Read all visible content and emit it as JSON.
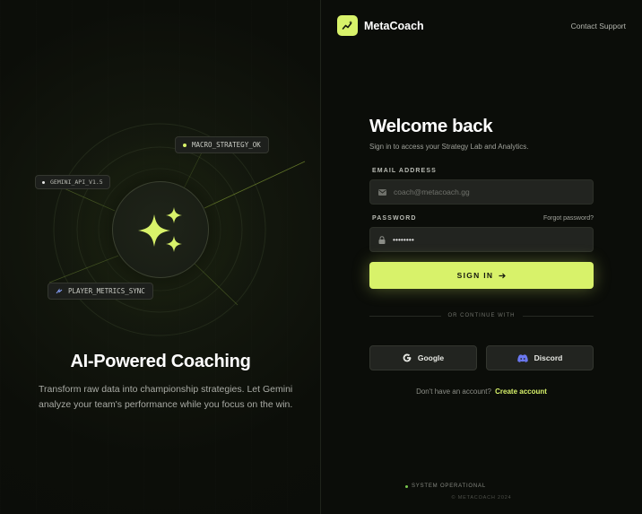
{
  "hero": {
    "title": "AI-Powered Coaching",
    "description": "Transform raw data into championship strategies. Let Gemini analyze your team's performance while you focus on the win.",
    "chips": {
      "gemini": "GEMINI_API_V1.5",
      "macro": "MACRO_STRATEGY_OK",
      "player": "PLAYER_METRICS_SYNC"
    },
    "icon": "sparkles-icon"
  },
  "brand": {
    "name": "MetaCoach",
    "logo_icon": "chart-sparkle-icon",
    "accent": "#d8f26a"
  },
  "header": {
    "support_label": "Contact Support"
  },
  "form": {
    "title": "Welcome back",
    "subtitle": "Sign in to access your Strategy Lab and Analytics.",
    "email": {
      "label": "EMAIL ADDRESS",
      "placeholder": "coach@metacoach.gg",
      "icon": "mail-icon"
    },
    "password": {
      "label": "PASSWORD",
      "value": "••••••••",
      "icon": "lock-icon",
      "forgot": "Forgot password?"
    },
    "submit_label": "SIGN IN",
    "divider": "OR CONTINUE WITH",
    "social": {
      "google": "Google",
      "discord": "Discord"
    },
    "signup_prompt": "Don't have an account?",
    "signup_link": "Create account"
  },
  "footer": {
    "status": "SYSTEM OPERATIONAL",
    "copyright": "© METACOACH 2024"
  }
}
